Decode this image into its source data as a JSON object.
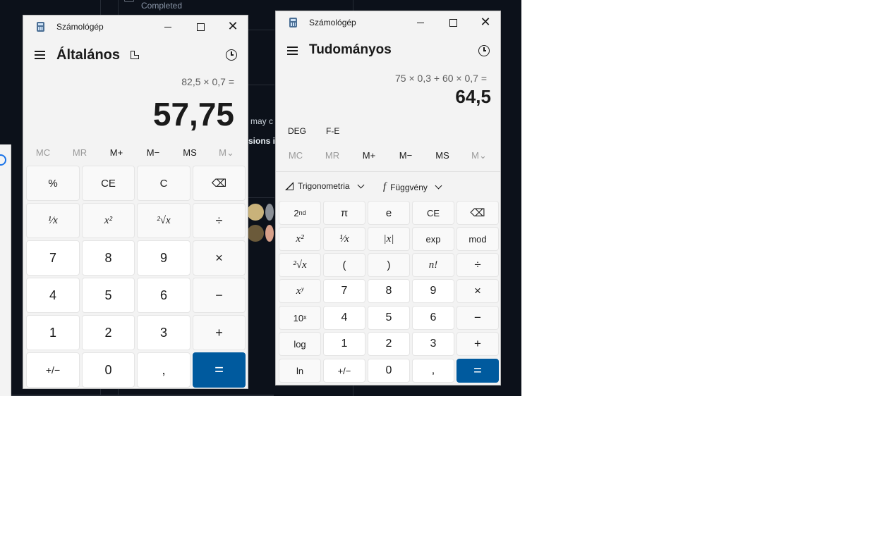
{
  "background_app": {
    "status_text": "Completed",
    "snippet_1": "may c",
    "snippet_2": "sions i"
  },
  "standard_calc": {
    "window_title": "Számológép",
    "mode": "Általános",
    "expression": "82,5 × 0,7 =",
    "result": "57,75",
    "memory": [
      "MC",
      "MR",
      "M+",
      "M−",
      "MS",
      "M⌄"
    ],
    "keys": [
      [
        "%",
        "CE",
        "C",
        "⌫"
      ],
      [
        "¹⁄x",
        "x²",
        "²√x",
        "÷"
      ],
      [
        "7",
        "8",
        "9",
        "×"
      ],
      [
        "4",
        "5",
        "6",
        "−"
      ],
      [
        "1",
        "2",
        "3",
        "+"
      ],
      [
        "+/−",
        "0",
        ",",
        "="
      ]
    ]
  },
  "scientific_calc": {
    "window_title": "Számológép",
    "mode": "Tudományos",
    "expression": "75 × 0,3 + 60 × 0,7 =",
    "result": "64,5",
    "angle_unit": "DEG",
    "fe_label": "F-E",
    "memory": [
      "MC",
      "MR",
      "M+",
      "M−",
      "MS",
      "M⌄"
    ],
    "trig_label": "Trigonometria",
    "func_label": "Függvény",
    "keys": {
      "second": "2nd",
      "pi": "π",
      "e": "e",
      "ce": "CE",
      "x_squared": "x²",
      "reciprocal": "¹⁄x",
      "abs": "|x|",
      "exp": "exp",
      "mod": "mod",
      "sqrt": "²√x",
      "lparen": "(",
      "rparen": ")",
      "factorial": "n!",
      "divide": "÷",
      "x_pow_y": "xʸ",
      "seven": "7",
      "eight": "8",
      "nine": "9",
      "multiply": "×",
      "ten_pow_x": "10ˣ",
      "four": "4",
      "five": "5",
      "six": "6",
      "minus": "−",
      "log": "log",
      "one": "1",
      "two": "2",
      "three": "3",
      "plus": "+",
      "ln": "ln",
      "negate": "+/−",
      "zero": "0",
      "decimal": ",",
      "equals": "="
    }
  }
}
